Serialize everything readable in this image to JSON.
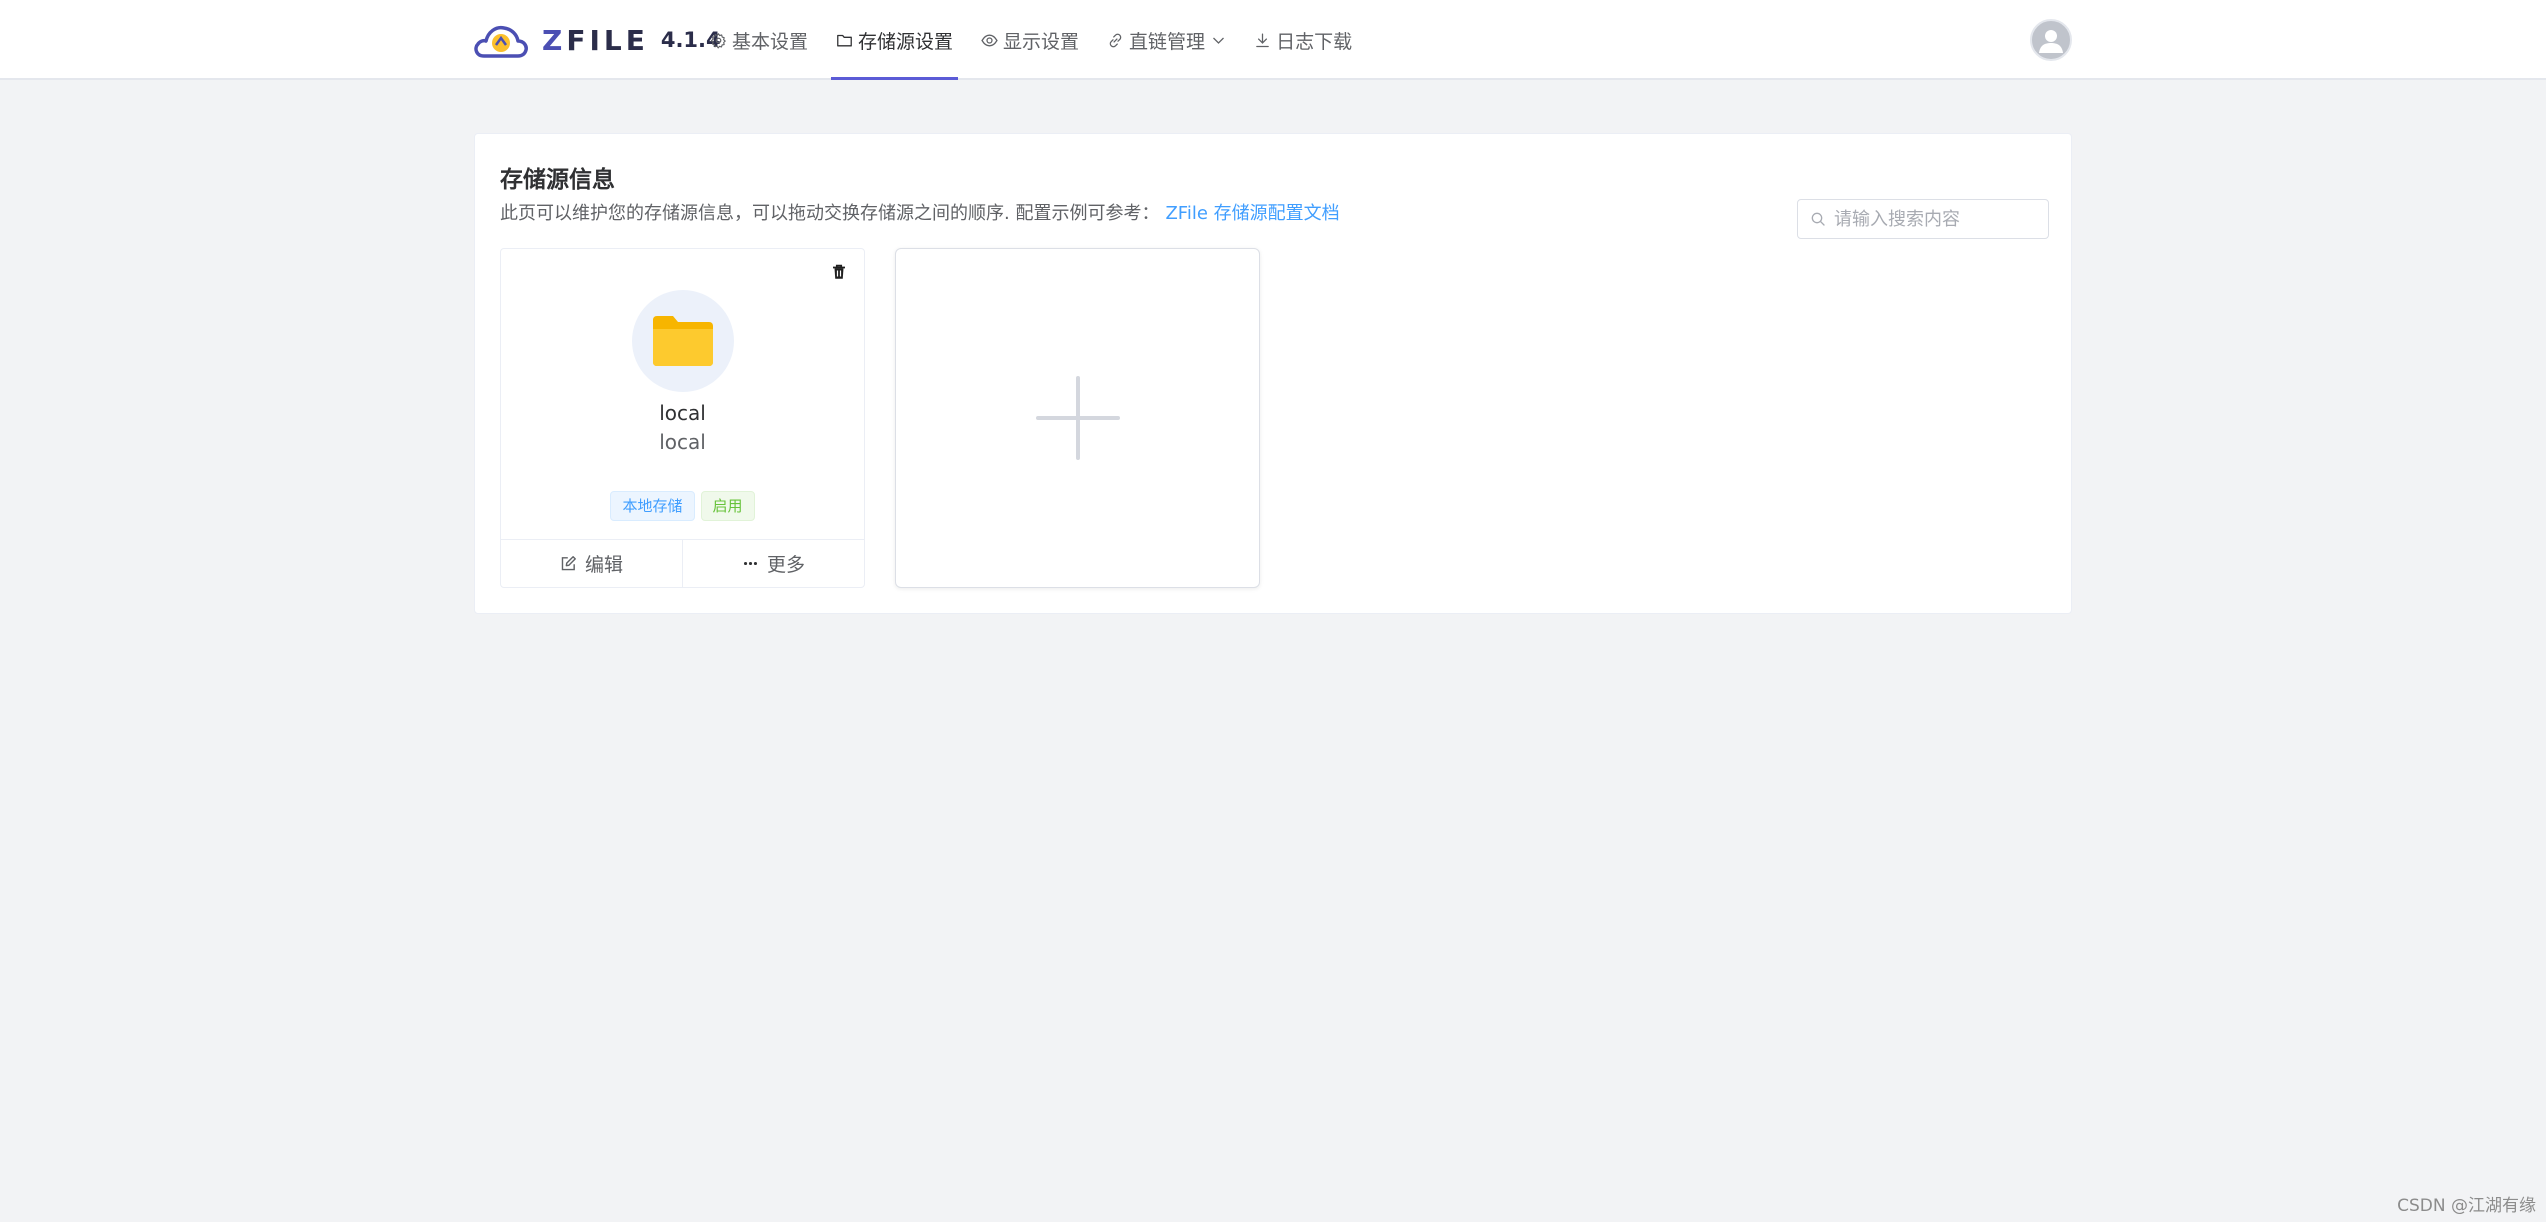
{
  "header": {
    "brand": "ZFILE",
    "brand_z": "Z",
    "brand_rest": "FILE",
    "version": "4.1.4",
    "nav": [
      {
        "label": "基本设置",
        "icon": "gear-icon"
      },
      {
        "label": "存储源设置",
        "icon": "folder-icon",
        "active": true
      },
      {
        "label": "显示设置",
        "icon": "eye-icon"
      },
      {
        "label": "直链管理",
        "icon": "link-icon"
      },
      {
        "label": "日志下载",
        "icon": "download-icon"
      }
    ],
    "avatar_icon": "user-avatar-icon"
  },
  "panel": {
    "title": "存储源信息",
    "description": "此页可以维护您的存储源信息，可以拖动交换存储源之间的顺序. 配置示例可参考：",
    "doc_link": "ZFile 存储源配置文档",
    "search_placeholder": "请输入搜索内容"
  },
  "storage_cards": [
    {
      "name": "local",
      "sub": "local",
      "tags": [
        "本地存储",
        "启用"
      ],
      "actions": {
        "edit": "编辑",
        "more": "更多"
      }
    }
  ],
  "watermark": "CSDN @江湖有缘",
  "colors": {
    "accent": "#5b5bd6",
    "link": "#409eff",
    "tag_blue": "#409eff",
    "tag_green": "#67c23a",
    "folder": "#fbc02d",
    "background": "#f2f3f5"
  }
}
